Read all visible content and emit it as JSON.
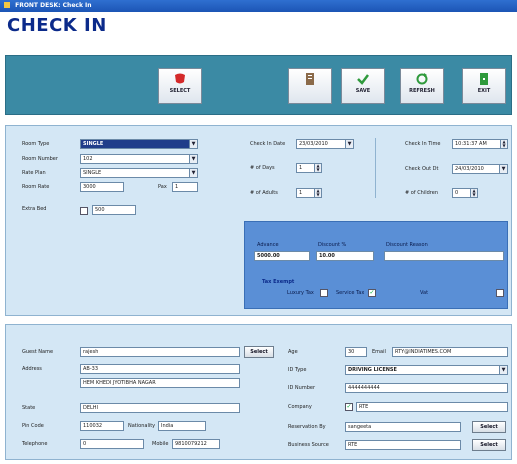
{
  "window": {
    "title": "FRONT DESK: Check In"
  },
  "page": {
    "heading": "CHECK IN"
  },
  "toolbar": {
    "select_label": "SELECT",
    "save_label": "SAVE",
    "refresh_label": "REFRESH",
    "exit_label": "EXIT",
    "colors": {
      "bar": "#3b8aa4",
      "select_icon": "#d42a2a",
      "save_icon": "#2f9a3c",
      "exit_icon": "#2f9a3c"
    }
  },
  "room": {
    "room_type_label": "Room Type",
    "room_type_value": "SINGLE",
    "room_number_label": "Room Number",
    "room_number_value": "102",
    "rate_plan_label": "Rate Plan",
    "rate_plan_value": "SINGLE",
    "room_rate_label": "Room Rate",
    "room_rate_value": "3000",
    "pax_label": "Pax",
    "pax_value": "1",
    "extra_bed_label": "Extra Bed",
    "extra_bed_value": "500"
  },
  "dates": {
    "checkin_date_label": "Check In Date",
    "checkin_date_value": "23/03/2010",
    "no_of_days_label": "# of Days",
    "no_of_days_value": "1",
    "no_of_adults_label": "# of Adults",
    "no_of_adults_value": "1",
    "checkin_time_label": "Check In Time",
    "checkin_time_value": "10:31:37 AM",
    "checkout_label": "Check Out Dt",
    "checkout_value": "24/03/2010",
    "no_of_children_label": "# of Children",
    "no_of_children_value": "0"
  },
  "advance": {
    "advance_label": "Advance",
    "advance_value": "5000.00",
    "discount_label": "Discount %",
    "discount_value": "10.00",
    "discount_reason_label": "Discount Reason",
    "discount_reason_value": "",
    "tax_exempt_label": "Tax Exempt",
    "luxury_tax_label": "Luxury Tax",
    "service_tax_label": "Service Tax",
    "vat_label": "Vat",
    "service_tax_checked": "✓"
  },
  "guest": {
    "guest_name_label": "Guest Name",
    "guest_name_value": "rajesh",
    "select_label": "Select",
    "address_label": "Address",
    "address_line1": "AB-33",
    "address_line2": "HEM KHEDI JYOTIBHA NAGAR",
    "state_label": "State",
    "state_value": "DELHI",
    "pin_code_label": "Pin Code",
    "pin_code_value": "110032",
    "nationality_label": "Nationality",
    "nationality_value": "India",
    "telephone_label": "Telephone",
    "telephone_value": "0",
    "mobile_label": "Mobile",
    "mobile_value": "9810079212",
    "age_label": "Age",
    "age_value": "30",
    "email_label": "Email",
    "email_value": "RTY@INDIATIMES.COM",
    "id_type_label": "ID Type",
    "id_type_value": "DRIVING LICENSE",
    "id_number_label": "ID Number",
    "id_number_value": "4444444444",
    "company_label": "Company",
    "company_value": "RTE",
    "company_checked": "✓",
    "reservation_by_label": "Reservation By",
    "reservation_by_value": "sangeeta",
    "business_source_label": "Business Source",
    "business_source_value": "RTE",
    "select_reservation_label": "Select",
    "select_business_label": "Select"
  }
}
